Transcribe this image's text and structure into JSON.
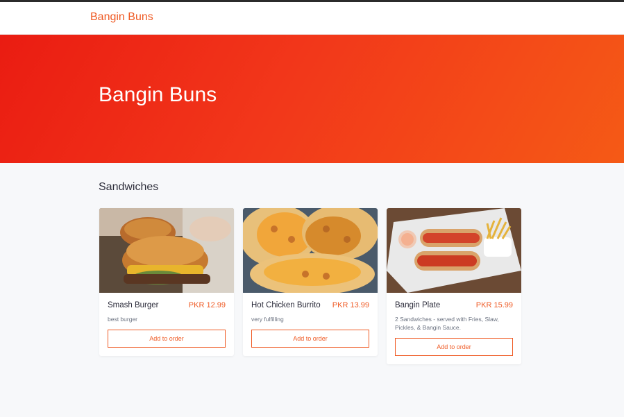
{
  "nav": {
    "brand": "Bangin Buns"
  },
  "hero": {
    "title": "Bangin Buns"
  },
  "colors": {
    "accent": "#ef5a24",
    "hero_start": "#ea1c12",
    "hero_end": "#f55a16"
  },
  "menu": {
    "section_title": "Sandwiches",
    "items": [
      {
        "name": "Smash Burger",
        "price": "PKR 12.99",
        "description": "best burger",
        "button_label": "Add to order",
        "image": "smash-burger-photo"
      },
      {
        "name": "Hot Chicken Burrito",
        "price": "PKR 13.99",
        "description": "very fulfilling",
        "button_label": "Add to order",
        "image": "burrito-photo"
      },
      {
        "name": "Bangin Plate",
        "price": "PKR 15.99",
        "description": "2 Sandwiches - served with Fries, Slaw, Pickles, & Bangin Sauce.",
        "button_label": "Add to order",
        "image": "bangin-plate-photo"
      }
    ]
  }
}
